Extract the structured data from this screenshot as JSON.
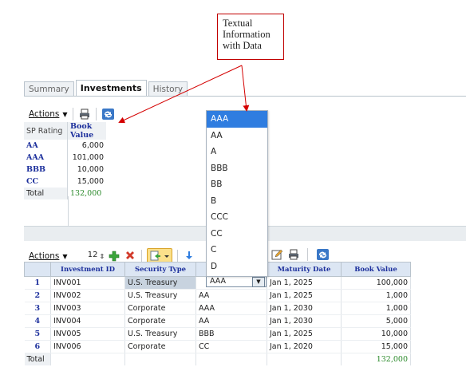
{
  "callout": {
    "lines": [
      "Textual",
      "Information",
      "with Data"
    ]
  },
  "tabs": [
    {
      "label": "Summary",
      "active": false
    },
    {
      "label": "Investments",
      "active": true
    },
    {
      "label": "History",
      "active": false
    }
  ],
  "top_toolbar": {
    "actions_label": "Actions"
  },
  "summary": {
    "headers": [
      "SP Rating",
      "Book Value"
    ],
    "rows": [
      {
        "rating": "AA",
        "value": "6,000"
      },
      {
        "rating": "AAA",
        "value": "101,000"
      },
      {
        "rating": "BBB",
        "value": "10,000"
      },
      {
        "rating": "CC",
        "value": "15,000"
      }
    ],
    "total_label": "Total",
    "total_value": "132,000"
  },
  "bottom_toolbar": {
    "actions_label": "Actions",
    "rows_value": "12"
  },
  "grid": {
    "headers": [
      "Investment ID",
      "Security Type",
      "",
      "Maturity Date",
      "Book Value"
    ],
    "rows": [
      {
        "n": "1",
        "id": "INV001",
        "type": "U.S. Treasury",
        "rating": "AAA",
        "maturity": "Jan 1, 2025",
        "value": "100,000"
      },
      {
        "n": "2",
        "id": "INV002",
        "type": "U.S. Treasury",
        "rating": "AA",
        "maturity": "Jan 1, 2025",
        "value": "1,000"
      },
      {
        "n": "3",
        "id": "INV003",
        "type": "Corporate",
        "rating": "AAA",
        "maturity": "Jan 1, 2030",
        "value": "1,000"
      },
      {
        "n": "4",
        "id": "INV004",
        "type": "Corporate",
        "rating": "AA",
        "maturity": "Jan 1, 2030",
        "value": "5,000"
      },
      {
        "n": "5",
        "id": "INV005",
        "type": "U.S. Treasury",
        "rating": "BBB",
        "maturity": "Jan 1, 2025",
        "value": "10,000"
      },
      {
        "n": "6",
        "id": "INV006",
        "type": "Corporate",
        "rating": "CC",
        "maturity": "Jan 1, 2020",
        "value": "15,000"
      }
    ],
    "total_label": "Total",
    "total_value": "132,000"
  },
  "dropdown": {
    "options": [
      "AAA",
      "AA",
      "A",
      "BBB",
      "BB",
      "B",
      "CCC",
      "CC",
      "C",
      "D"
    ],
    "selected": "AAA"
  },
  "colors": {
    "accent": "#2f7de0",
    "header_text": "#1c2f9c",
    "callout_border": "#c00000",
    "arrow": "#d40000",
    "total_green": "#2b8a2b"
  }
}
